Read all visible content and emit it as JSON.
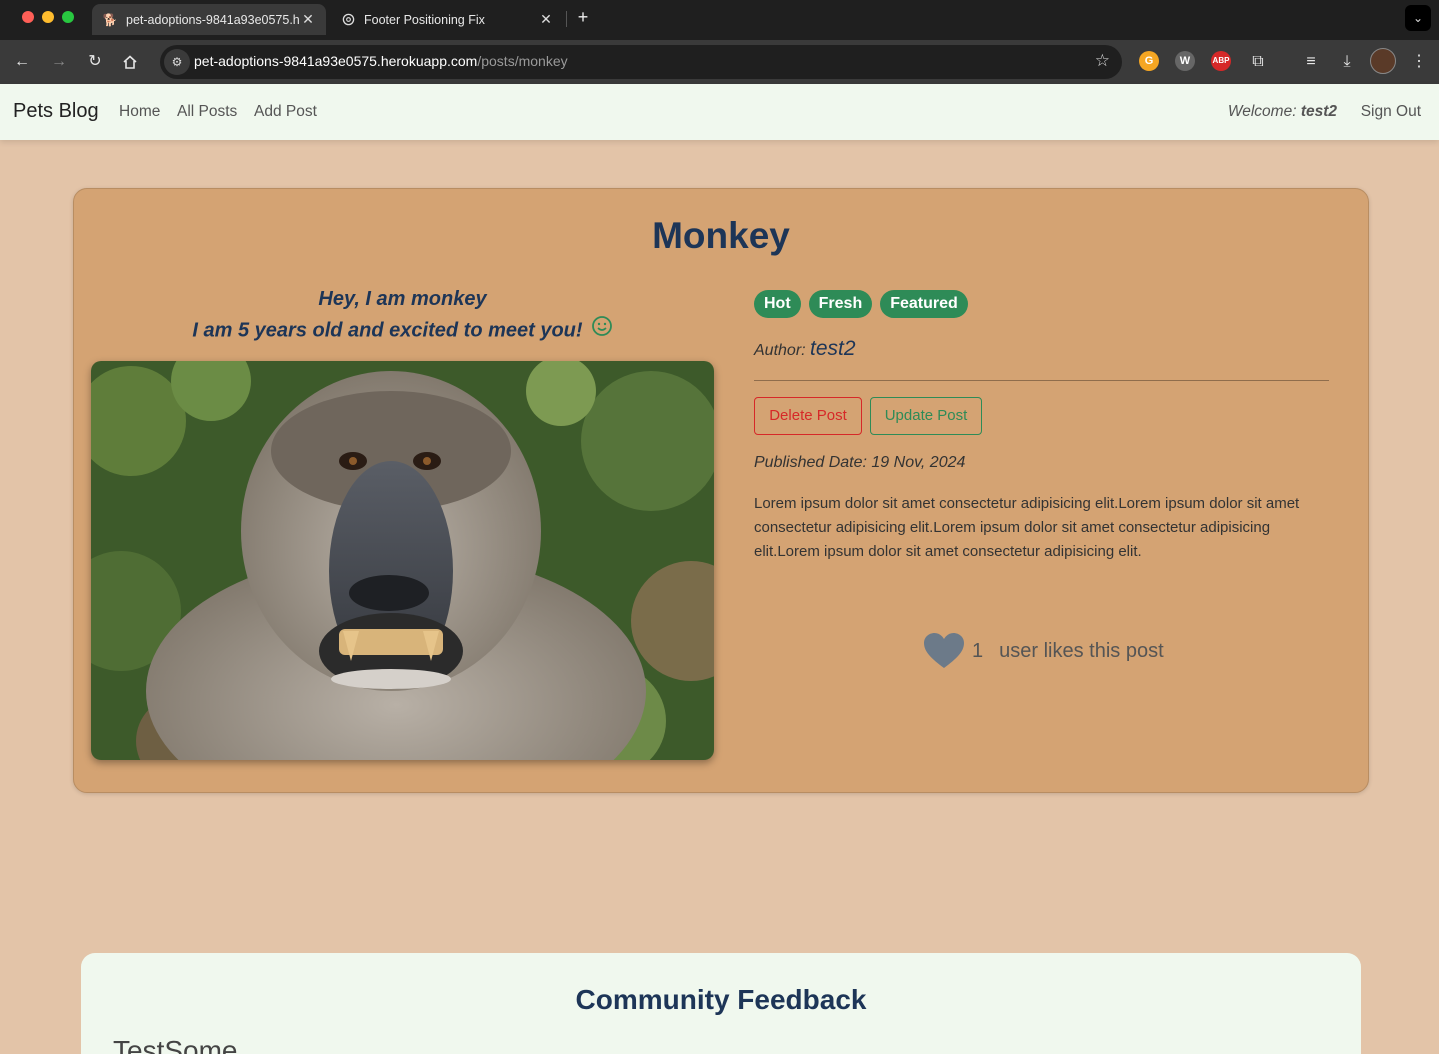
{
  "browser": {
    "tabs": [
      {
        "title": "pet-adoptions-9841a93e0575.herokuapp.com/posts/monkey",
        "active": true,
        "favicon": "dog-icon"
      },
      {
        "title": "Footer Positioning Fix",
        "active": false,
        "favicon": "openai-icon"
      }
    ],
    "url_host": "pet-adoptions-9841a93e0575.herokuapp.com",
    "url_path": "/posts/monkey"
  },
  "nav": {
    "brand": "Pets Blog",
    "links": [
      "Home",
      "All Posts",
      "Add Post"
    ],
    "welcome_label": "Welcome:",
    "username": "test2",
    "signout": "Sign Out"
  },
  "post": {
    "title": "Monkey",
    "intro_line1": "Hey, I am monkey",
    "intro_line2": "I am 5 years old and excited to meet you!",
    "badges": [
      "Hot",
      "Fresh",
      "Featured"
    ],
    "author_label": "Author:",
    "author_name": "test2",
    "delete_label": "Delete Post",
    "update_label": "Update Post",
    "published": "Published Date: 19 Nov, 2024",
    "body": "Lorem ipsum dolor sit amet consectetur adipisicing elit.Lorem ipsum dolor sit amet consectetur adipisicing elit.Lorem ipsum dolor sit amet consectetur adipisicing elit.Lorem ipsum dolor sit amet consectetur adipisicing elit.",
    "like_count": "1",
    "like_text": "user likes this post"
  },
  "feedback": {
    "title": "Community Feedback",
    "first_item": "TestSome"
  },
  "colors": {
    "page_bg": "#e3c4a8",
    "card_bg": "#d4a373",
    "nav_bg": "#f0f8ee",
    "heading": "#1d3557",
    "badge": "#2e8b57",
    "danger": "#d62828"
  }
}
